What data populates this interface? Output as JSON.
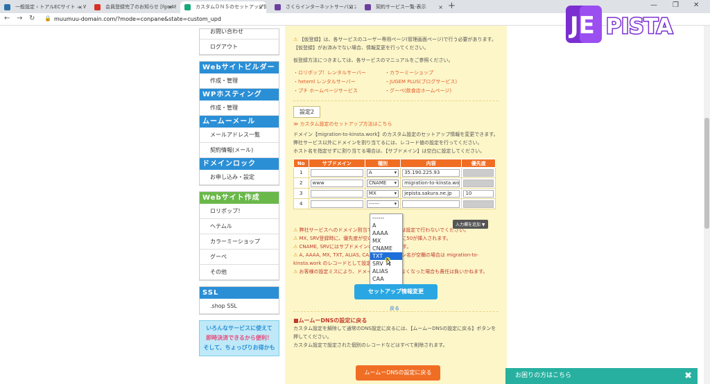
{
  "browser": {
    "tabs": [
      {
        "title": "一般設定 ‹ トアルECサイト — Wor",
        "icon": "wordpress-icon",
        "color": "#2c6fa8"
      },
      {
        "title": "会員登録完了のお知らせ [fgw48223",
        "icon": "gmail-icon",
        "color": "#d93025"
      },
      {
        "title": "カスタムＤＮＳのセットアップ情報変",
        "icon": "muumuu-icon",
        "color": "#16a87a",
        "active": true
      },
      {
        "title": "さくらインターネットサーバコントロールパ",
        "icon": "sakura-icon",
        "color": "#6b3fa0"
      },
      {
        "title": "契約サービス一覧-表示",
        "icon": "sakura-icon",
        "color": "#6b3fa0"
      }
    ],
    "new_tab": "+",
    "url": "muumuu-domain.com/?mode=conpane&state=custom_upd"
  },
  "logo": {
    "text": "JEPISTA",
    "brand_color": "#7b2fd1"
  },
  "sidebar": {
    "top_items": [
      "お問い合わせ",
      "ログアウト"
    ],
    "sections": [
      {
        "header": "Webサイトビルダー",
        "items": [
          "作成・管理"
        ]
      },
      {
        "header": "WPホスティング",
        "items": [
          "作成・管理"
        ]
      },
      {
        "header": "ムームーメール",
        "items": [
          "メールアドレス一覧",
          "契約情報(メール)"
        ]
      },
      {
        "header": "ドメインロック",
        "items": [
          "お申し込み・設定"
        ]
      }
    ],
    "web_section": {
      "header": "Webサイト作成",
      "items": [
        "ロリポップ！",
        "ヘテムル",
        "カラーミーショップ",
        "グーペ",
        "その他"
      ]
    },
    "ssl_section": {
      "header": "SSL",
      "items": [
        ".shop SSL"
      ]
    },
    "banner": {
      "line1": "いろんなサービスに使えて",
      "line2": "即時決済できるから便利！",
      "line3": "そして、ちょっぴりお得かも"
    }
  },
  "main": {
    "top_notes": [
      "【仮登録】は、各サービスのユーザー専用ページ(管理画面ページ)で行う必要があります。",
      "【仮登録】がお済みでない場合、情報変更を行ってください。",
      "仮登録方法につきましては、各サービスのマニュアルをご参照ください。"
    ],
    "service_links": [
      "・ロリポップ！レンタルサーバー",
      "・カラーミーショップ",
      "・heteml レンタルサーバー",
      "・JUGEM PLUS(ブログサービス)",
      "・プチ ホームページサービス",
      "・グーペ(飲食店ホームページ)"
    ],
    "setting_label": "設定2",
    "custom_link": "≫ カスタム設定のセットアップ方法はこちら",
    "domain_desc1": "ドメイン【migration-to-kinsta.work】のカスタム設定のセットアップ情報を変更できます。弊社サービス以外にドメインを割り当てるには、レコード値の設定を行ってください。",
    "domain_desc2": "ホスト名を指定せずに割り当てる場合は、【サブドメイン】は空白に設定してください。",
    "table": {
      "headers": [
        "No",
        "サブドメイン",
        "種別",
        "内容",
        "優先度"
      ],
      "rows": [
        {
          "no": "1",
          "sub": "",
          "type": "A",
          "content": "35.190.225.93",
          "prio": ""
        },
        {
          "no": "2",
          "sub": "www",
          "type": "CNAME",
          "content": "migration-to-kinsta.wo",
          "prio": ""
        },
        {
          "no": "3",
          "sub": "",
          "type": "MX",
          "content": "jepista.sakura.ne.jp",
          "prio": "10"
        },
        {
          "no": "4",
          "sub": "",
          "type": "------",
          "content": "",
          "prio": ""
        }
      ]
    },
    "add_rows_btn": "入力欄を追加 ▼",
    "dropdown_options": [
      "------",
      "A",
      "AAAA",
      "MX",
      "CNAME",
      "TXT",
      "SRV",
      "ALIAS",
      "CAA"
    ],
    "dropdown_highlight": "TXT",
    "warnings": [
      "弊社サービスへのドメイン割当てはこの画面では設定で行わないでください。",
      "MX, SRV登録時に、優先度が空の場合は自動的に50が挿入されます。",
      "CNAME, SRVにはサブドメインの入力が必須です。",
      "A, AAAA, MX, TXT, ALIAS, CAAのサブドメイン名が空欄の場合は migration-to-kinsta.work のレコードとして設定されます。",
      "お客様の設定ミスにより、ドメインが使用できなくなった場合も責任は負いかねます。"
    ],
    "setup_button": "セットアップ情報変更",
    "back_link": "戻る",
    "reset_heading": "■ムームーDNSの設定に戻る",
    "reset_desc1": "カスタム設定を解除して通常のDNS設定に戻るには、【ムームーDNSの設定に戻る】ボタンを押してください。",
    "reset_desc2": "カスタム設定で設定された個別のレコードなどはすべて削除されます。",
    "reset_button": "ムームーDNSの設定に戻る"
  },
  "help_bar": {
    "label": "お困りの方はこちら",
    "close": "✖"
  }
}
